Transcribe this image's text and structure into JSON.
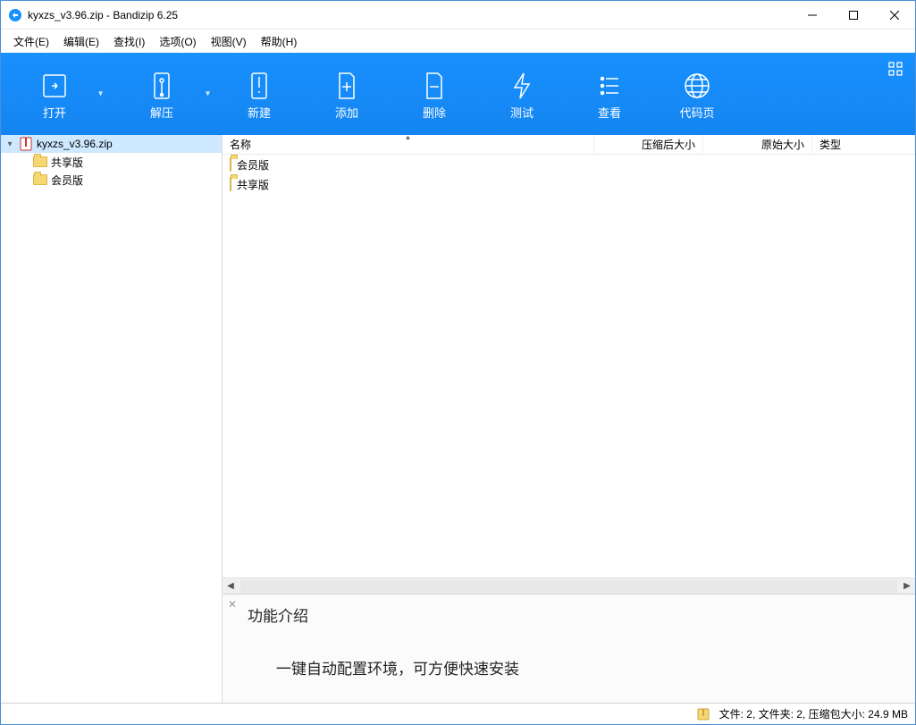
{
  "title": "kyxzs_v3.96.zip - Bandizip 6.25",
  "menus": {
    "file": "文件(E)",
    "edit": "编辑(E)",
    "find": "查找(I)",
    "options": "选项(O)",
    "view": "视图(V)",
    "help": "帮助(H)"
  },
  "toolbar": {
    "open": "打开",
    "extract": "解压",
    "new": "新建",
    "add": "添加",
    "delete": "删除",
    "test": "测试",
    "view": "查看",
    "codepage": "代码页"
  },
  "tree": {
    "root": "kyxzs_v3.96.zip",
    "children": [
      {
        "label": "共享版"
      },
      {
        "label": "会员版"
      }
    ]
  },
  "columns": {
    "name": "名称",
    "packed": "压缩后大小",
    "original": "原始大小",
    "type": "类型"
  },
  "list": [
    {
      "name": "会员版"
    },
    {
      "name": "共享版"
    }
  ],
  "info": {
    "heading": "功能介绍",
    "desc": "一键自动配置环境，可方便快速安装"
  },
  "status": "文件: 2, 文件夹: 2, 压缩包大小: 24.9 MB"
}
